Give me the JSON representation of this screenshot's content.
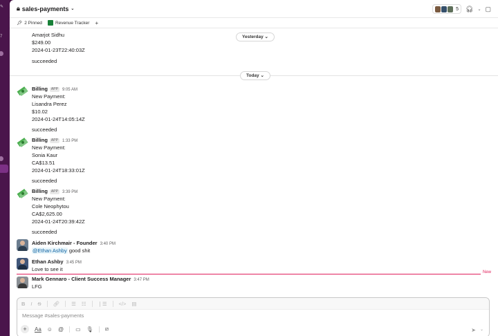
{
  "rail": {
    "badge": "7"
  },
  "header": {
    "channel": "sales-payments",
    "member_count": "5"
  },
  "bookmarks": {
    "pinned": "2 Pinned",
    "revenue": "Revenue Tracker",
    "add": "+"
  },
  "separators": {
    "yesterday": "Yesterday",
    "today": "Today"
  },
  "prev_message": {
    "lines": [
      "Amarjot Sidhu",
      "$249.00",
      "2024-01-23T22:40:03Z"
    ],
    "status": "succeeded"
  },
  "billing_messages": [
    {
      "sender": "Billing",
      "app_tag": "APP",
      "time": "9:05 AM",
      "lines": [
        "New Payment:",
        "Lisandra Perez",
        "$10.02",
        "2024-01-24T14:05:14Z"
      ],
      "status": "succeeded"
    },
    {
      "sender": "Billing",
      "app_tag": "APP",
      "time": "1:33 PM",
      "lines": [
        "New Payment:",
        "Sonia Kaur",
        "CA$13.51",
        "2024-01-24T18:33:01Z"
      ],
      "status": "succeeded"
    },
    {
      "sender": "Billing",
      "app_tag": "APP",
      "time": "3:39 PM",
      "lines": [
        "New Payment:",
        "Cole Neophytou",
        "CA$2,625.00",
        "2024-01-24T20:39:42Z"
      ],
      "status": "succeeded"
    }
  ],
  "user_messages": [
    {
      "sender": "Aiden Kirchmair - Founder",
      "time": "3:40 PM",
      "mention": "@Ethan Ashby",
      "text": " good shit"
    },
    {
      "sender": "Ethan Ashby",
      "time": "3:45 PM",
      "text": "Love to see it"
    },
    {
      "sender": "Mark Gennaro - Client Success Manager",
      "time": "3:47 PM",
      "text": "LFG"
    }
  ],
  "new_label": "New",
  "composer": {
    "placeholder": "Message #sales-payments"
  }
}
